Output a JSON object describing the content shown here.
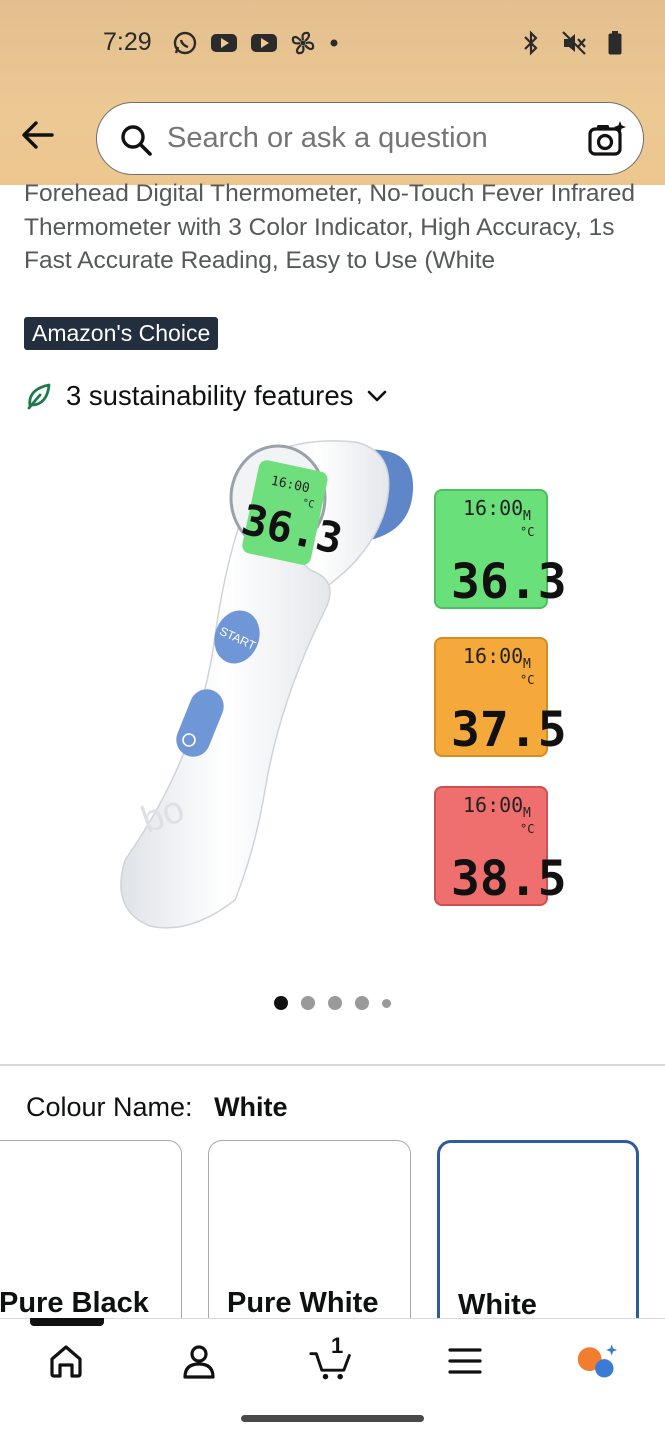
{
  "status_bar": {
    "time": "7:29",
    "left_icons": [
      "whatsapp-icon",
      "youtube-icon",
      "youtube-icon",
      "fan-icon",
      "dot-icon"
    ],
    "right_icons": [
      "bluetooth-icon",
      "mute-icon",
      "battery-icon"
    ]
  },
  "header": {
    "search_placeholder": "Search or ask a question",
    "accent": "#ecc893"
  },
  "product": {
    "title": "Forehead Digital Thermometer, No-Touch Fever Infrared Thermometer with 3 Color Indicator, High Accuracy, 1s Fast Accurate Reading, Easy to Use (White",
    "badge": "Amazon's Choice",
    "sustainability": "3 sustainability features",
    "image": {
      "screens": [
        {
          "time": "16:00",
          "mode": "M",
          "unit": "°C",
          "reading": "36.3",
          "color": "#69e07a"
        },
        {
          "time": "16:00",
          "mode": "M",
          "unit": "°C",
          "reading": "37.5",
          "color": "#f4a93a"
        },
        {
          "time": "16:00",
          "mode": "M",
          "unit": "°C",
          "reading": "38.5",
          "color": "#ef6e6e"
        }
      ],
      "device_reading": "36.3",
      "device_time": "16:00",
      "device_unit": "°C",
      "start_label": "START"
    },
    "carousel": {
      "count": 5,
      "active": 0
    }
  },
  "colour": {
    "label": "Colour Name:",
    "value": "White",
    "options": [
      "Pure Black",
      "Pure White",
      "White"
    ],
    "selected": "White"
  },
  "bottom_nav": {
    "items": [
      "home-icon",
      "account-icon",
      "cart-icon",
      "menu-icon",
      "rufus-icon"
    ],
    "cart_count": "1"
  }
}
